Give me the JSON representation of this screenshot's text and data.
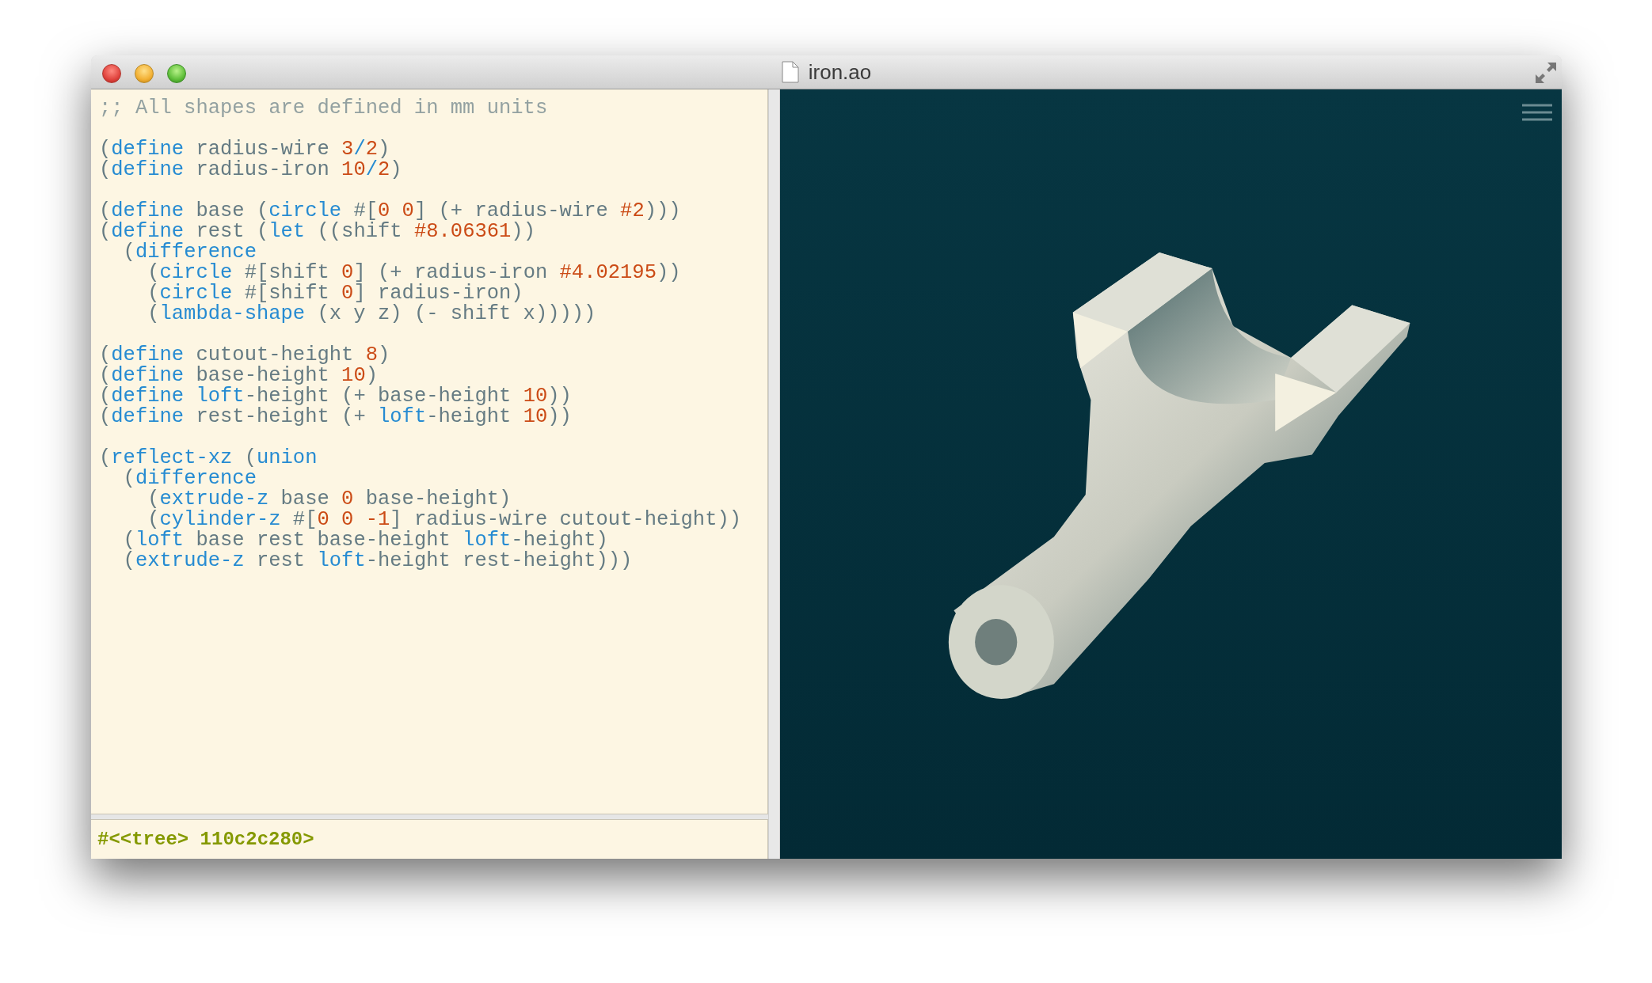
{
  "window": {
    "title": "iron.ao"
  },
  "editor": {
    "blocks": [
      [
        [
          {
            "kind": "comment",
            "text": ";; All shapes are defined in mm units"
          }
        ]
      ],
      [
        [
          {
            "kind": "plain",
            "text": "("
          },
          {
            "kind": "keyword",
            "text": "define"
          },
          {
            "kind": "plain",
            "text": " radius-wire "
          },
          {
            "kind": "number",
            "text": "3"
          },
          {
            "kind": "keyword",
            "text": "/"
          },
          {
            "kind": "number",
            "text": "2"
          },
          {
            "kind": "plain",
            "text": ")"
          }
        ],
        [
          {
            "kind": "plain",
            "text": "("
          },
          {
            "kind": "keyword",
            "text": "define"
          },
          {
            "kind": "plain",
            "text": " radius-iron "
          },
          {
            "kind": "number",
            "text": "10"
          },
          {
            "kind": "keyword",
            "text": "/"
          },
          {
            "kind": "number",
            "text": "2"
          },
          {
            "kind": "plain",
            "text": ")"
          }
        ]
      ],
      [
        [
          {
            "kind": "plain",
            "text": "("
          },
          {
            "kind": "keyword",
            "text": "define"
          },
          {
            "kind": "plain",
            "text": " base ("
          },
          {
            "kind": "keyword",
            "text": "circle"
          },
          {
            "kind": "plain",
            "text": " #["
          },
          {
            "kind": "number",
            "text": "0 0"
          },
          {
            "kind": "plain",
            "text": "] (+ radius-wire "
          },
          {
            "kind": "number",
            "text": "#2"
          },
          {
            "kind": "plain",
            "text": ")))"
          }
        ],
        [
          {
            "kind": "plain",
            "text": "("
          },
          {
            "kind": "keyword",
            "text": "define"
          },
          {
            "kind": "plain",
            "text": " rest ("
          },
          {
            "kind": "keyword",
            "text": "let"
          },
          {
            "kind": "plain",
            "text": " ((shift "
          },
          {
            "kind": "number",
            "text": "#8.06361"
          },
          {
            "kind": "plain",
            "text": "))"
          }
        ],
        [
          {
            "kind": "plain",
            "text": "  ("
          },
          {
            "kind": "keyword",
            "text": "difference"
          }
        ],
        [
          {
            "kind": "plain",
            "text": "    ("
          },
          {
            "kind": "keyword",
            "text": "circle"
          },
          {
            "kind": "plain",
            "text": " #[shift "
          },
          {
            "kind": "number",
            "text": "0"
          },
          {
            "kind": "plain",
            "text": "] (+ radius-iron "
          },
          {
            "kind": "number",
            "text": "#4.02195"
          },
          {
            "kind": "plain",
            "text": "))"
          }
        ],
        [
          {
            "kind": "plain",
            "text": "    ("
          },
          {
            "kind": "keyword",
            "text": "circle"
          },
          {
            "kind": "plain",
            "text": " #[shift "
          },
          {
            "kind": "number",
            "text": "0"
          },
          {
            "kind": "plain",
            "text": "] radius-iron)"
          }
        ],
        [
          {
            "kind": "plain",
            "text": "    ("
          },
          {
            "kind": "keyword",
            "text": "lambda-shape"
          },
          {
            "kind": "plain",
            "text": " (x y z) (- shift x)))))"
          }
        ]
      ],
      [
        [
          {
            "kind": "plain",
            "text": "("
          },
          {
            "kind": "keyword",
            "text": "define"
          },
          {
            "kind": "plain",
            "text": " cutout-height "
          },
          {
            "kind": "number",
            "text": "8"
          },
          {
            "kind": "plain",
            "text": ")"
          }
        ],
        [
          {
            "kind": "plain",
            "text": "("
          },
          {
            "kind": "keyword",
            "text": "define"
          },
          {
            "kind": "plain",
            "text": " base-height "
          },
          {
            "kind": "number",
            "text": "10"
          },
          {
            "kind": "plain",
            "text": ")"
          }
        ],
        [
          {
            "kind": "plain",
            "text": "("
          },
          {
            "kind": "keyword",
            "text": "define"
          },
          {
            "kind": "keyword",
            "text": " loft"
          },
          {
            "kind": "plain",
            "text": "-height (+ base-height "
          },
          {
            "kind": "number",
            "text": "10"
          },
          {
            "kind": "plain",
            "text": "))"
          }
        ],
        [
          {
            "kind": "plain",
            "text": "("
          },
          {
            "kind": "keyword",
            "text": "define"
          },
          {
            "kind": "plain",
            "text": " rest-height (+ "
          },
          {
            "kind": "keyword",
            "text": "loft"
          },
          {
            "kind": "plain",
            "text": "-height "
          },
          {
            "kind": "number",
            "text": "10"
          },
          {
            "kind": "plain",
            "text": "))"
          }
        ]
      ],
      [
        [
          {
            "kind": "plain",
            "text": "("
          },
          {
            "kind": "keyword",
            "text": "reflect-xz"
          },
          {
            "kind": "plain",
            "text": " ("
          },
          {
            "kind": "keyword",
            "text": "union"
          }
        ],
        [
          {
            "kind": "plain",
            "text": "  ("
          },
          {
            "kind": "keyword",
            "text": "difference"
          }
        ],
        [
          {
            "kind": "plain",
            "text": "    ("
          },
          {
            "kind": "keyword",
            "text": "extrude-z"
          },
          {
            "kind": "plain",
            "text": " base "
          },
          {
            "kind": "number",
            "text": "0"
          },
          {
            "kind": "plain",
            "text": " base-height)"
          }
        ],
        [
          {
            "kind": "plain",
            "text": "    ("
          },
          {
            "kind": "keyword",
            "text": "cylinder-z"
          },
          {
            "kind": "plain",
            "text": " #["
          },
          {
            "kind": "number",
            "text": "0 0 -1"
          },
          {
            "kind": "plain",
            "text": "] radius-wire cutout-height))"
          }
        ],
        [
          {
            "kind": "plain",
            "text": "  ("
          },
          {
            "kind": "keyword",
            "text": "loft"
          },
          {
            "kind": "plain",
            "text": " base rest base-height "
          },
          {
            "kind": "keyword",
            "text": "loft"
          },
          {
            "kind": "plain",
            "text": "-height)"
          }
        ],
        [
          {
            "kind": "plain",
            "text": "  ("
          },
          {
            "kind": "keyword",
            "text": "extrude-z"
          },
          {
            "kind": "plain",
            "text": " rest "
          },
          {
            "kind": "keyword",
            "text": "loft"
          },
          {
            "kind": "plain",
            "text": "-height rest-height)))"
          }
        ]
      ]
    ]
  },
  "result": "#<<tree> 110c2c280>"
}
